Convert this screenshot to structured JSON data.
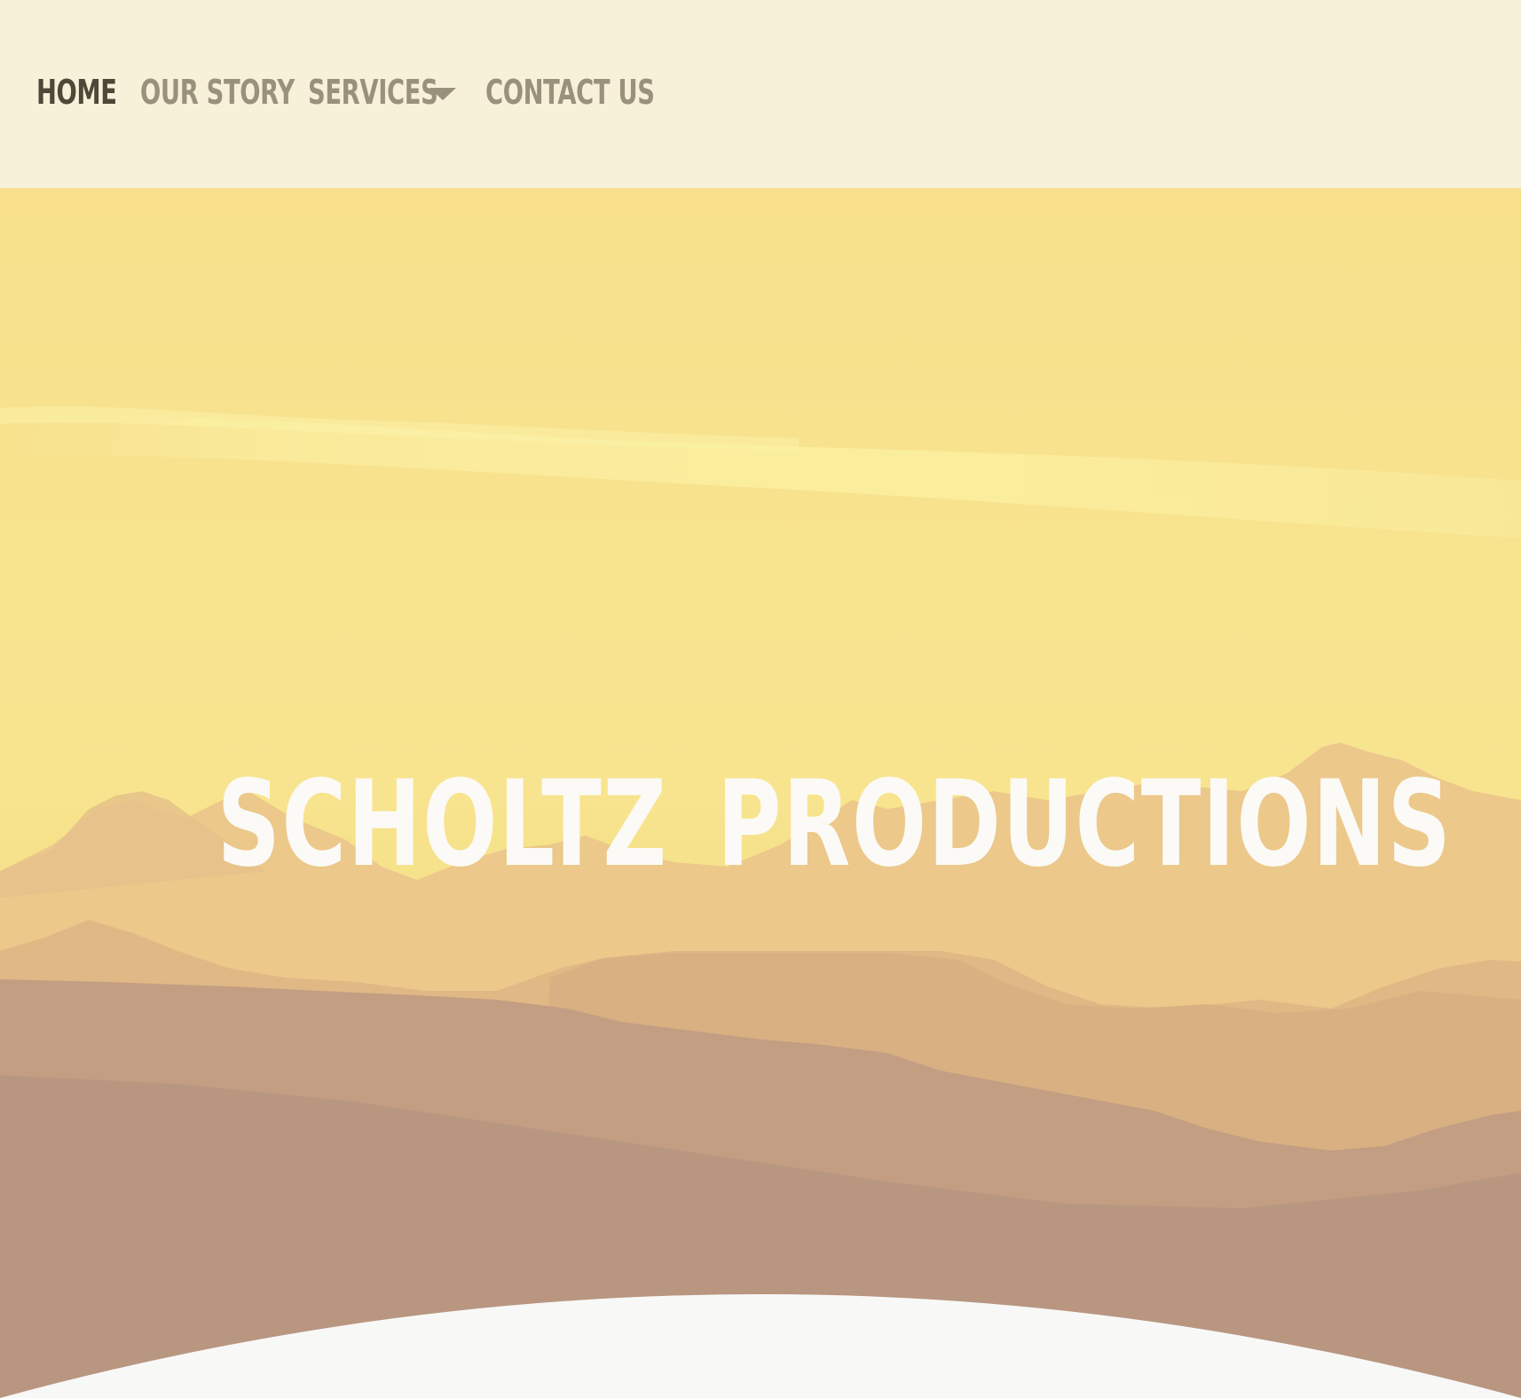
{
  "nav": {
    "items": [
      {
        "label": "HOME",
        "active": true
      },
      {
        "label": "OUR STORY",
        "active": false
      },
      {
        "label": "SERVICES",
        "active": false,
        "has_dropdown": true
      },
      {
        "label": "CONTACT US",
        "active": false
      }
    ],
    "dropdown_icon": "caret-down-icon"
  },
  "hero": {
    "title": "SCHOLTZ  PRODUCTIONS"
  },
  "colors": {
    "nav_background": "#f8f1da",
    "nav_active_text": "#4f4738",
    "nav_text": "#9a917c",
    "hero_sky": "#f6de86",
    "hero_title": "#fbfaf6",
    "footer_curve": "#f8f8f7"
  }
}
